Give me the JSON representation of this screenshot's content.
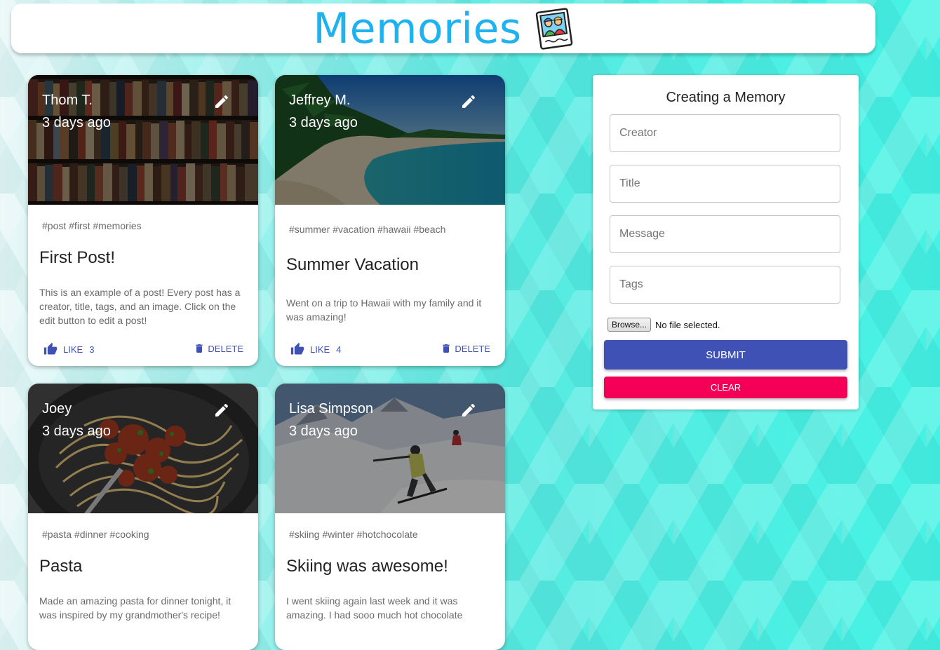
{
  "appbar": {
    "title": "Memories",
    "logo_icon": "photo-memories-icon"
  },
  "posts": [
    {
      "creator": "Thom T.",
      "time": "3 days ago",
      "tags": "#post #first #memories",
      "title": "First Post!",
      "message": "This is an example of a post! Every post has a creator, title, tags, and an image. Click on the edit button to edit a post!",
      "like_label": "LIKE",
      "like_count": "3",
      "delete_label": "DELETE",
      "image": "bookshelf"
    },
    {
      "creator": "Jeffrey M.",
      "time": "3 days ago",
      "tags": "#summer #vacation #hawaii #beach",
      "title": "Summer Vacation",
      "message": "Went on a trip to Hawaii with my family and it was amazing!",
      "like_label": "LIKE",
      "like_count": "4",
      "delete_label": "DELETE",
      "image": "beach"
    },
    {
      "creator": "Joey",
      "time": "3 days ago",
      "tags": "#pasta #dinner #cooking",
      "title": "Pasta",
      "message": "Made an amazing pasta for dinner tonight, it was inspired by my grandmother's recipe!",
      "image": "pasta"
    },
    {
      "creator": "Lisa Simpson",
      "time": "3 days ago",
      "tags": "#skiing #winter #hotchocolate",
      "title": "Skiing was awesome!",
      "message": "I went skiing again last week and it was amazing. I had sooo much hot chocolate",
      "image": "skiing"
    }
  ],
  "form": {
    "title": "Creating a Memory",
    "creator_placeholder": "Creator",
    "title_placeholder": "Title",
    "message_placeholder": "Message",
    "tags_placeholder": "Tags",
    "browse_label": "Browse...",
    "file_status": "No file selected.",
    "submit_label": "SUBMIT",
    "clear_label": "CLEAR"
  },
  "colors": {
    "brand": "#1eb2ee",
    "primary": "#3f51b5",
    "secondary": "#f50057"
  }
}
